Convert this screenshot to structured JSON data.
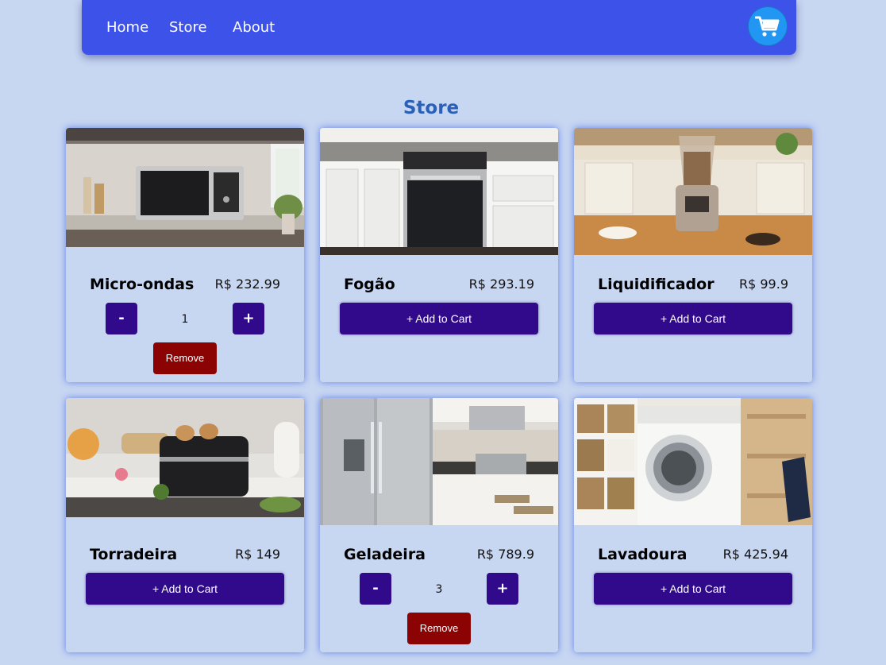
{
  "nav": {
    "links": [
      "Home",
      "Store",
      "About"
    ]
  },
  "page": {
    "title": "Store"
  },
  "colors": {
    "navbar": "#3d52e9",
    "background": "#c7d6f1",
    "primary_button": "#300a8a",
    "remove_button": "#8b0303",
    "cart_button": "#2196f3",
    "title": "#2a60b8"
  },
  "icons": {
    "cart": "shopping-cart-icon"
  },
  "products": [
    {
      "name": "Micro-ondas",
      "price": "R$ 232.99",
      "in_cart": true,
      "quantity": "1",
      "image": "microwave-photo"
    },
    {
      "name": "Fogão",
      "price": "R$ 293.19",
      "in_cart": false,
      "image": "stove-photo"
    },
    {
      "name": "Liquidificador",
      "price": "R$ 99.9",
      "in_cart": false,
      "image": "blender-photo"
    },
    {
      "name": "Torradeira",
      "price": "R$ 149",
      "in_cart": false,
      "image": "toaster-photo"
    },
    {
      "name": "Geladeira",
      "price": "R$ 789.9",
      "in_cart": true,
      "quantity": "3",
      "image": "refrigerator-photo"
    },
    {
      "name": "Lavadoura",
      "price": "R$ 425.94",
      "in_cart": false,
      "image": "washing-machine-photo"
    }
  ],
  "buttons": {
    "add_to_cart": "+ Add to Cart",
    "remove": "Remove",
    "decrement": "-",
    "increment": "+"
  }
}
